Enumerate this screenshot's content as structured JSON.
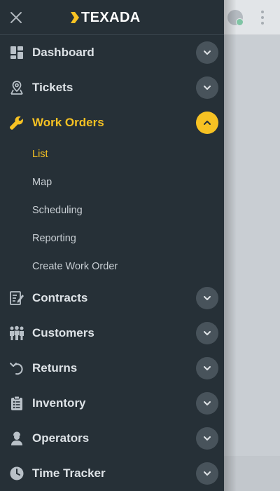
{
  "brand": {
    "name": "TEXADA"
  },
  "header": {
    "close_icon": "close-icon"
  },
  "nav": [
    {
      "key": "dashboard",
      "label": "Dashboard",
      "icon": "dashboard-icon",
      "expanded": false
    },
    {
      "key": "tickets",
      "label": "Tickets",
      "icon": "map-pin-icon",
      "expanded": false
    },
    {
      "key": "work-orders",
      "label": "Work Orders",
      "icon": "wrench-icon",
      "expanded": true,
      "active": true,
      "children": [
        {
          "label": "List",
          "active": true
        },
        {
          "label": "Map"
        },
        {
          "label": "Scheduling"
        },
        {
          "label": "Reporting"
        },
        {
          "label": "Create Work Order"
        }
      ]
    },
    {
      "key": "contracts",
      "label": "Contracts",
      "icon": "contract-icon",
      "expanded": false
    },
    {
      "key": "customers",
      "label": "Customers",
      "icon": "people-icon",
      "expanded": false
    },
    {
      "key": "returns",
      "label": "Returns",
      "icon": "undo-icon",
      "expanded": false
    },
    {
      "key": "inventory",
      "label": "Inventory",
      "icon": "clipboard-list-icon",
      "expanded": false
    },
    {
      "key": "operators",
      "label": "Operators",
      "icon": "operator-icon",
      "expanded": false
    },
    {
      "key": "time-tracker",
      "label": "Time Tracker",
      "icon": "clock-icon",
      "expanded": false
    }
  ],
  "colors": {
    "drawer_bg": "#263037",
    "accent": "#f7c223",
    "chevron_bg": "#48535b",
    "text": "#dde2e6"
  }
}
